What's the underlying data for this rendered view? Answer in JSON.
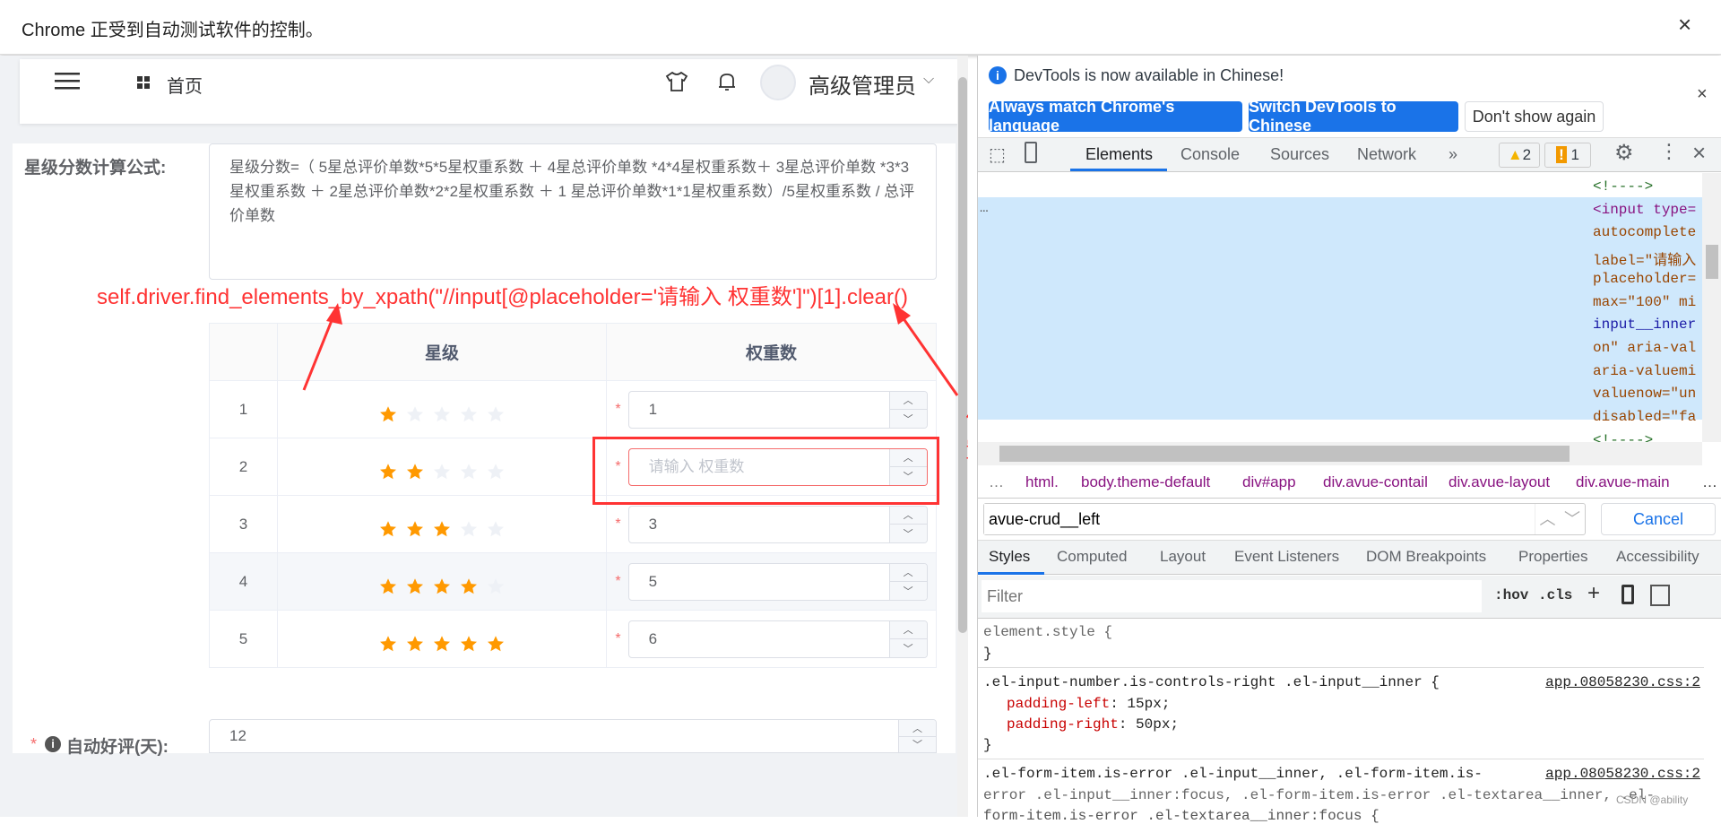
{
  "infobar": {
    "text": "Chrome 正受到自动测试软件的控制。",
    "close": "×"
  },
  "header": {
    "home": "首页",
    "user": "高级管理员"
  },
  "form": {
    "formula_label": "星级分数计算公式:",
    "formula": "星级分数=（ 5星总评价单数*5*5星权重系数 ＋ 4星总评价单数 *4*4星权重系数＋ 3星总评价单数 *3*3星权重系数 ＋ 2星总评价单数*2*2星权重系数 ＋ 1 星总评价单数*1*1星权重系数）/5星权重系数 / 总评价单数",
    "table": {
      "col_star": "星级",
      "col_weight": "权重数",
      "placeholder": "请输入 权重数",
      "rows": [
        {
          "index": "1",
          "stars": 1,
          "value": "1"
        },
        {
          "index": "2",
          "stars": 2,
          "value": ""
        },
        {
          "index": "3",
          "stars": 3,
          "value": "3"
        },
        {
          "index": "4",
          "stars": 4,
          "value": "5"
        },
        {
          "index": "5",
          "stars": 5,
          "value": "6"
        }
      ]
    },
    "auto_label": "自动好评(天):",
    "auto_value": "12"
  },
  "annotation": {
    "code": "self.driver.find_elements_by_xpath(\"//input[@placeholder='请输入 权重数']\")[1].clear()",
    "position": "位置"
  },
  "colors": {
    "star_on": "#ff9900",
    "star_off": "#eef1f6",
    "annotation": "#ff3333",
    "devtools_blue": "#1a73e8"
  },
  "devtools": {
    "notice": "DevTools is now available in Chinese!",
    "btn_match": "Always match Chrome's language",
    "btn_switch": "Switch DevTools to Chinese",
    "btn_dont": "Don't show again",
    "tabs": [
      "Elements",
      "Console",
      "Sources",
      "Network",
      "»"
    ],
    "warnings": "2",
    "issues": "1",
    "code_lines": [
      "<!---->",
      "<input type=",
      "autocomplete",
      "label=\"请输入",
      "placeholder=",
      "max=\"100\" mi",
      "input__inner",
      "on\" aria-val",
      "aria-valuemi",
      "valuenow=\"un",
      "disabled=\"fa",
      "<!---->"
    ],
    "ellipsis": "…",
    "breadcrumbs": [
      "html.",
      "body.theme-default",
      "div#app",
      "div.avue-contail",
      "div.avue-layout",
      "div.avue-main"
    ],
    "search_value": "avue-crud__left",
    "cancel": "Cancel",
    "style_tabs": [
      "Styles",
      "Computed",
      "Layout",
      "Event Listeners",
      "DOM Breakpoints",
      "Properties",
      "Accessibility"
    ],
    "filter_placeholder": "Filter",
    "hov": ":hov",
    "cls": ".cls",
    "rules": {
      "r0": "element.style {",
      "close": "}",
      "r1_sel": ".el-input-number.is-controls-right .el-input__inner {",
      "r1_src": "app.08058230.css:2",
      "r1_p1n": "padding-left",
      "r1_p1v": ": 15px;",
      "r1_p2n": "padding-right",
      "r1_p2v": ": 50px;",
      "r2_l1": ".el-form-item.is-error .el-input__inner, .el-form-item.is-",
      "r2_l2": "error .el-input__inner:focus, .el-form-item.is-error .el-textarea__inner, .el-",
      "r2_l3": "form-item.is-error .el-textarea__inner:focus {",
      "r2_src": "app.08058230.css:2"
    },
    "watermark": "CSDN @ability"
  }
}
